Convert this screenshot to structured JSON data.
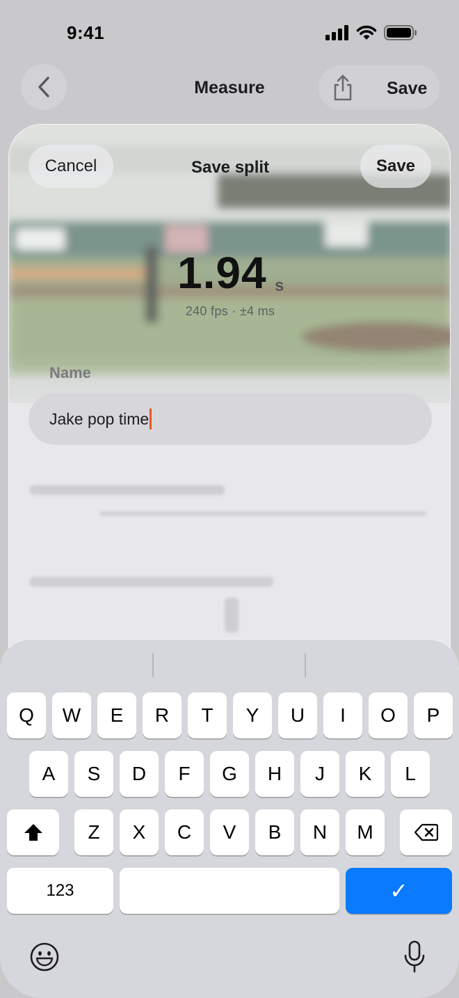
{
  "status_bar": {
    "time": "9:41"
  },
  "nav": {
    "title": "Measure",
    "save_label": "Save"
  },
  "sheet": {
    "cancel_label": "Cancel",
    "title": "Save split",
    "save_label": "Save",
    "time_value": "1.94",
    "time_unit": "s",
    "meta": "240 fps · ±4 ms",
    "name_label": "Name",
    "name_value": "Jake pop time"
  },
  "keyboard": {
    "row1": [
      "Q",
      "W",
      "E",
      "R",
      "T",
      "Y",
      "U",
      "I",
      "O",
      "P"
    ],
    "row2": [
      "A",
      "S",
      "D",
      "F",
      "G",
      "H",
      "J",
      "K",
      "L"
    ],
    "row3": [
      "Z",
      "X",
      "C",
      "V",
      "B",
      "N",
      "M"
    ],
    "numbers_label": "123",
    "return_glyph": "✓",
    "accent_color": "#0a7aff"
  },
  "icons": [
    "back-chevron-icon",
    "share-icon",
    "shift-icon",
    "delete-icon",
    "emoji-icon",
    "microphone-icon",
    "signal-icon",
    "wifi-icon",
    "battery-icon"
  ]
}
